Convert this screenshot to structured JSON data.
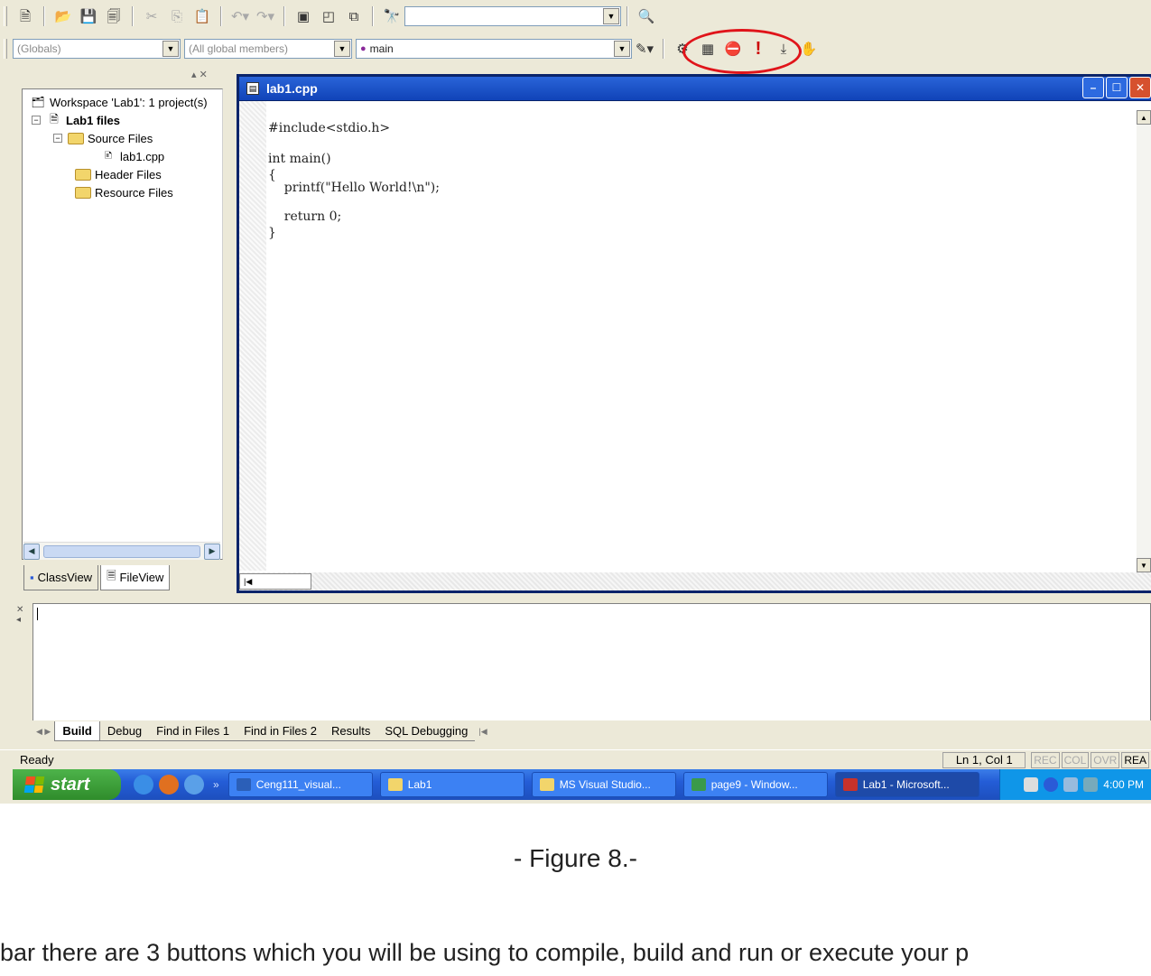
{
  "toolbar": {
    "find_combo_value": "",
    "buttons": [
      "new-text-file",
      "open",
      "save",
      "save-all",
      "cut",
      "copy",
      "paste",
      "undo",
      "redo",
      "workspace",
      "output",
      "window-list",
      "find-in-files",
      "find"
    ]
  },
  "wizardbar": {
    "class_combo": "(Globals)",
    "members_combo": "(All global members)",
    "function_combo": "main",
    "build_buttons": [
      "compile",
      "build",
      "stop-build",
      "execute",
      "go",
      "insert-remove-breakpoint"
    ]
  },
  "workspace": {
    "items": [
      {
        "label": "Workspace 'Lab1': 1 project(s)"
      },
      {
        "label": "Lab1 files"
      },
      {
        "label": "Source Files"
      },
      {
        "label": "lab1.cpp"
      },
      {
        "label": "Header Files"
      },
      {
        "label": "Resource Files"
      }
    ],
    "tabs": [
      "ClassView",
      "FileView"
    ]
  },
  "editor": {
    "title": "lab1.cpp",
    "code_lines": [
      "#include<stdio.h>",
      "int main()",
      "{",
      "    printf(\"Hello World!\\n\");",
      "    return 0;",
      "}"
    ]
  },
  "output": {
    "tabs": [
      "Build",
      "Debug",
      "Find in Files 1",
      "Find in Files 2",
      "Results",
      "SQL Debugging"
    ]
  },
  "status": {
    "ready": "Ready",
    "position": "Ln 1, Col 1",
    "indicators": [
      "REC",
      "COL",
      "OVR",
      "REA"
    ]
  },
  "taskbar": {
    "start": "start",
    "tasks": [
      "Ceng111_visual...",
      "Lab1",
      "MS Visual Studio...",
      "page9 - Window...",
      "Lab1 - Microsoft..."
    ],
    "clock": "4:00 PM"
  },
  "document": {
    "caption": "- Figure 8.-",
    "paragraph": "bar there are 3 buttons which you will be using to compile, build and run or execute your p"
  },
  "colors": {
    "title_bar": "#1043b8",
    "taskbar": "#245dd7",
    "start_button": "#2f8c2b",
    "highlight_oval": "#e0141a",
    "execute_icon": "#cc0000"
  }
}
